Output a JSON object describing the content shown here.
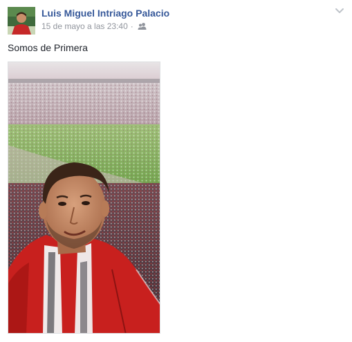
{
  "post": {
    "author_name": "Luis Miguel Intriago Palacio",
    "timestamp": "15 de mayo a las 23:40",
    "separator": "·",
    "audience_icon": "friends-icon",
    "options_icon": "chevron-down-icon",
    "text": "Somos de Primera",
    "avatar_icon": "profile-photo",
    "photo_icon": "stadium-selfie-photo"
  },
  "colors": {
    "author_link": "#365899",
    "meta_text": "#90949c",
    "body_text": "#1d2129",
    "background": "#ffffff"
  }
}
